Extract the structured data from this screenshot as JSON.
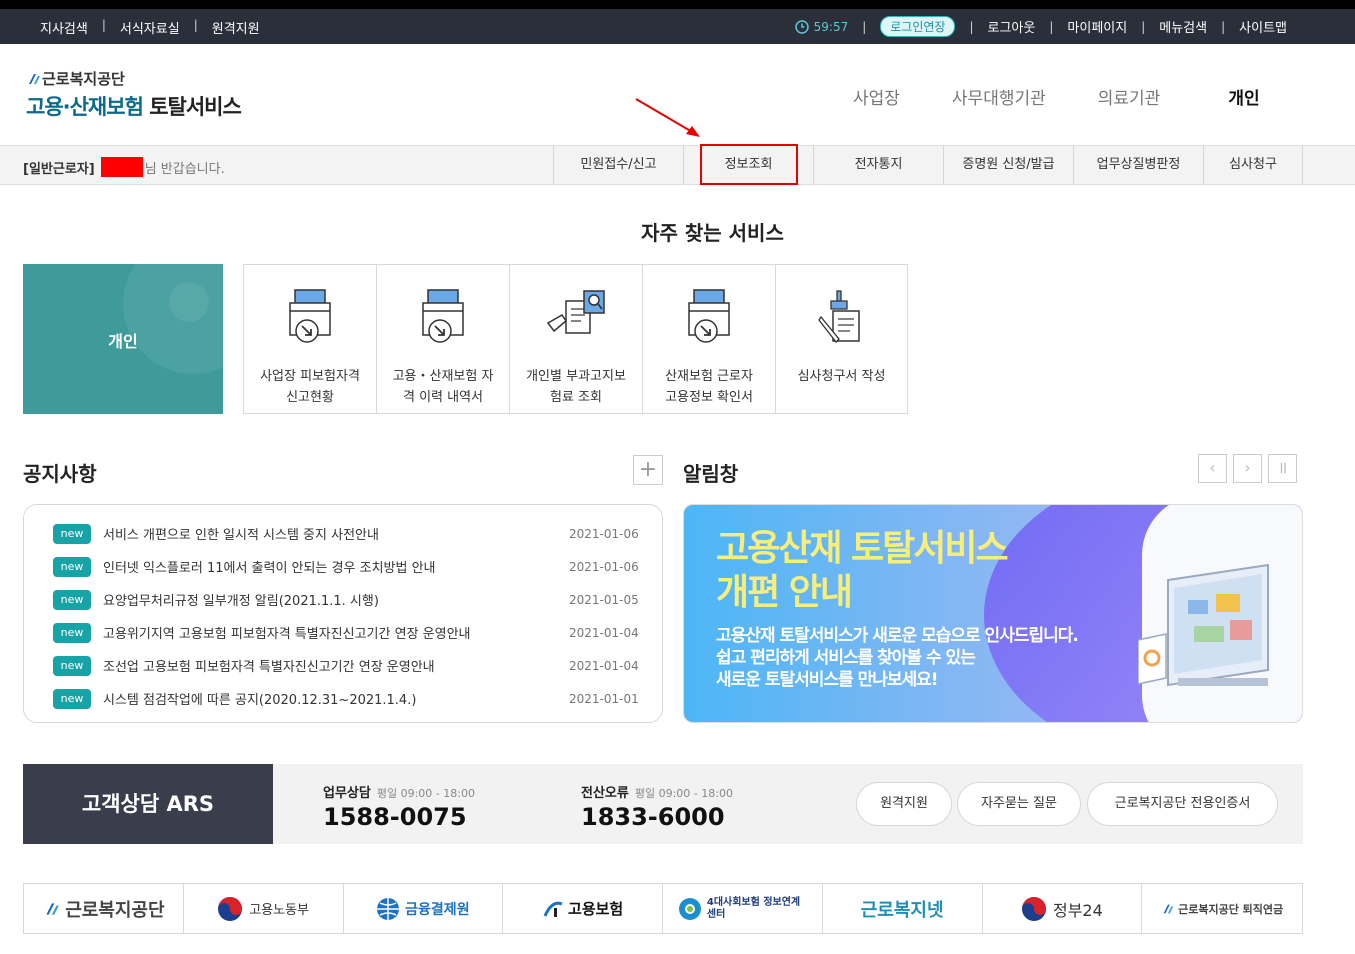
{
  "topbar": {
    "left_links": [
      "지사검색",
      "서식자료실",
      "원격지원"
    ],
    "timer": "59:57",
    "extend": "로그인연장",
    "right_links": [
      "로그아웃",
      "마이페이지",
      "메뉴검색",
      "사이트맵"
    ]
  },
  "header": {
    "org": "근로복지공단",
    "service_prefix": "고용·산재보험",
    "service_suffix": "토탈서비스",
    "nav": [
      "사업장",
      "사무대행기관",
      "의료기관"
    ],
    "nav_active": "개인"
  },
  "subbar": {
    "role": "[일반근로자]",
    "greeting": "님 반갑습니다.",
    "menu": [
      "민원접수/신고",
      "정보조회",
      "전자통지",
      "증명원 신청/발급",
      "업무상질병판정",
      "심사청구"
    ]
  },
  "favorites": {
    "title": "자주 찾는 서비스",
    "category": "개인",
    "items": [
      {
        "line1": "사업장 피보험자격",
        "line2": "신고현황",
        "icon": "printer-download-icon"
      },
      {
        "line1": "고용・산재보험 자",
        "line2": "격 이력 내역서",
        "icon": "printer-download-icon"
      },
      {
        "line1": "개인별 부과고지보",
        "line2": "험료 조회",
        "icon": "magnify-document-icon"
      },
      {
        "line1": "산재보험 근로자",
        "line2": "고용정보 확인서",
        "icon": "printer-download-icon"
      },
      {
        "line1": "심사청구서 작성",
        "line2": "",
        "icon": "pen-document-icon"
      }
    ]
  },
  "notice": {
    "title": "공지사항",
    "badge": "new",
    "items": [
      {
        "title": "서비스 개편으로 인한 일시적 시스템 중지 사전안내",
        "date": "2021-01-06"
      },
      {
        "title": "인터넷 익스플로러 11에서 출력이 안되는 경우 조치방법 안내",
        "date": "2021-01-06"
      },
      {
        "title": "요양업무처리규정 일부개정 알림(2021.1.1. 시행)",
        "date": "2021-01-05"
      },
      {
        "title": "고용위기지역 고용보험 피보험자격 특별자진신고기간 연장 운영안내",
        "date": "2021-01-04"
      },
      {
        "title": "조선업 고용보험 피보험자격 특별자진신고기간 연장 운영안내",
        "date": "2021-01-04"
      },
      {
        "title": "시스템 점검작업에 따른 공지(2020.12.31~2021.1.4.)",
        "date": "2021-01-01"
      }
    ]
  },
  "alert": {
    "title": "알림창",
    "banner_line1": "고용산재 토탈서비스",
    "banner_line2": "개편 안내",
    "banner_p1": "고용산재 토탈서비스가 새로운 모습으로 인사드립니다.",
    "banner_p2": "쉽고 편리하게 서비스를 찾아볼 수 있는",
    "banner_p3": "새로운 토탈서비스를 만나보세요!"
  },
  "ars": {
    "lead": "고객상담 ARS",
    "work_label": "업무상담",
    "work_hours": "평일 09:00 - 18:00",
    "work_number": "1588-0075",
    "it_label": "전산오류",
    "it_hours": "평일 09:00 - 18:00",
    "it_number": "1833-6000",
    "buttons": [
      "원격지원",
      "자주묻는 질문",
      "근로복지공단 전용인증서"
    ]
  },
  "footer": {
    "links": [
      "근로복지공단",
      "고용노동부",
      "금융결제원",
      "고용보험",
      "4대사회보험 정보연계센터",
      "근로복지넷",
      "정부24",
      "근로복지공단 퇴직연금"
    ]
  },
  "colors": {
    "teal": "#18a3a7",
    "dark": "#2b2f3a",
    "highlight_red": "#e60000"
  }
}
